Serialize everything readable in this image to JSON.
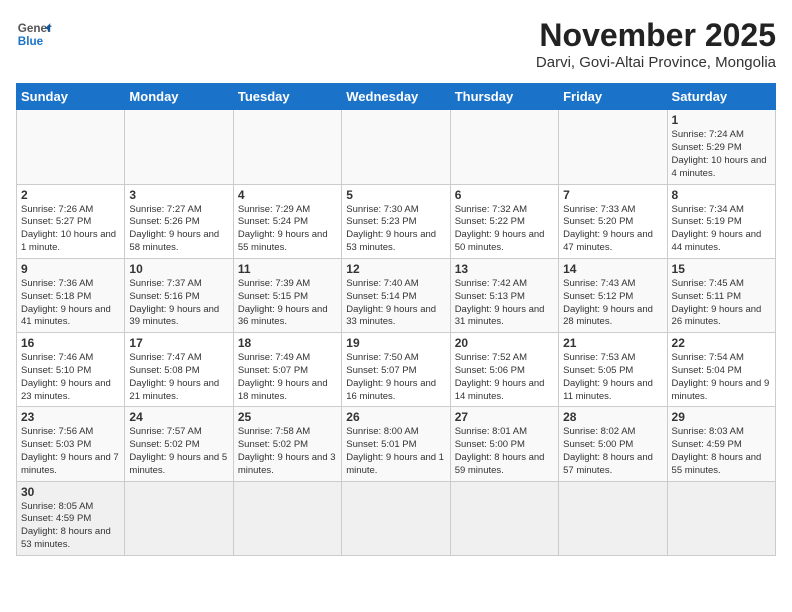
{
  "header": {
    "logo_line1": "General",
    "logo_line2": "Blue",
    "month": "November 2025",
    "location": "Darvi, Govi-Altai Province, Mongolia"
  },
  "days_of_week": [
    "Sunday",
    "Monday",
    "Tuesday",
    "Wednesday",
    "Thursday",
    "Friday",
    "Saturday"
  ],
  "weeks": [
    {
      "cells": [
        {
          "day": "",
          "info": ""
        },
        {
          "day": "",
          "info": ""
        },
        {
          "day": "",
          "info": ""
        },
        {
          "day": "",
          "info": ""
        },
        {
          "day": "",
          "info": ""
        },
        {
          "day": "",
          "info": ""
        },
        {
          "day": "1",
          "info": "Sunrise: 7:24 AM\nSunset: 5:29 PM\nDaylight: 10 hours\nand 4 minutes."
        }
      ]
    },
    {
      "cells": [
        {
          "day": "2",
          "info": "Sunrise: 7:26 AM\nSunset: 5:27 PM\nDaylight: 10 hours\nand 1 minute."
        },
        {
          "day": "3",
          "info": "Sunrise: 7:27 AM\nSunset: 5:26 PM\nDaylight: 9 hours\nand 58 minutes."
        },
        {
          "day": "4",
          "info": "Sunrise: 7:29 AM\nSunset: 5:24 PM\nDaylight: 9 hours\nand 55 minutes."
        },
        {
          "day": "5",
          "info": "Sunrise: 7:30 AM\nSunset: 5:23 PM\nDaylight: 9 hours\nand 53 minutes."
        },
        {
          "day": "6",
          "info": "Sunrise: 7:32 AM\nSunset: 5:22 PM\nDaylight: 9 hours\nand 50 minutes."
        },
        {
          "day": "7",
          "info": "Sunrise: 7:33 AM\nSunset: 5:20 PM\nDaylight: 9 hours\nand 47 minutes."
        },
        {
          "day": "8",
          "info": "Sunrise: 7:34 AM\nSunset: 5:19 PM\nDaylight: 9 hours\nand 44 minutes."
        }
      ]
    },
    {
      "cells": [
        {
          "day": "9",
          "info": "Sunrise: 7:36 AM\nSunset: 5:18 PM\nDaylight: 9 hours\nand 41 minutes."
        },
        {
          "day": "10",
          "info": "Sunrise: 7:37 AM\nSunset: 5:16 PM\nDaylight: 9 hours\nand 39 minutes."
        },
        {
          "day": "11",
          "info": "Sunrise: 7:39 AM\nSunset: 5:15 PM\nDaylight: 9 hours\nand 36 minutes."
        },
        {
          "day": "12",
          "info": "Sunrise: 7:40 AM\nSunset: 5:14 PM\nDaylight: 9 hours\nand 33 minutes."
        },
        {
          "day": "13",
          "info": "Sunrise: 7:42 AM\nSunset: 5:13 PM\nDaylight: 9 hours\nand 31 minutes."
        },
        {
          "day": "14",
          "info": "Sunrise: 7:43 AM\nSunset: 5:12 PM\nDaylight: 9 hours\nand 28 minutes."
        },
        {
          "day": "15",
          "info": "Sunrise: 7:45 AM\nSunset: 5:11 PM\nDaylight: 9 hours\nand 26 minutes."
        }
      ]
    },
    {
      "cells": [
        {
          "day": "16",
          "info": "Sunrise: 7:46 AM\nSunset: 5:10 PM\nDaylight: 9 hours\nand 23 minutes."
        },
        {
          "day": "17",
          "info": "Sunrise: 7:47 AM\nSunset: 5:08 PM\nDaylight: 9 hours\nand 21 minutes."
        },
        {
          "day": "18",
          "info": "Sunrise: 7:49 AM\nSunset: 5:07 PM\nDaylight: 9 hours\nand 18 minutes."
        },
        {
          "day": "19",
          "info": "Sunrise: 7:50 AM\nSunset: 5:07 PM\nDaylight: 9 hours\nand 16 minutes."
        },
        {
          "day": "20",
          "info": "Sunrise: 7:52 AM\nSunset: 5:06 PM\nDaylight: 9 hours\nand 14 minutes."
        },
        {
          "day": "21",
          "info": "Sunrise: 7:53 AM\nSunset: 5:05 PM\nDaylight: 9 hours\nand 11 minutes."
        },
        {
          "day": "22",
          "info": "Sunrise: 7:54 AM\nSunset: 5:04 PM\nDaylight: 9 hours\nand 9 minutes."
        }
      ]
    },
    {
      "cells": [
        {
          "day": "23",
          "info": "Sunrise: 7:56 AM\nSunset: 5:03 PM\nDaylight: 9 hours\nand 7 minutes."
        },
        {
          "day": "24",
          "info": "Sunrise: 7:57 AM\nSunset: 5:02 PM\nDaylight: 9 hours\nand 5 minutes."
        },
        {
          "day": "25",
          "info": "Sunrise: 7:58 AM\nSunset: 5:02 PM\nDaylight: 9 hours\nand 3 minutes."
        },
        {
          "day": "26",
          "info": "Sunrise: 8:00 AM\nSunset: 5:01 PM\nDaylight: 9 hours\nand 1 minute."
        },
        {
          "day": "27",
          "info": "Sunrise: 8:01 AM\nSunset: 5:00 PM\nDaylight: 8 hours\nand 59 minutes."
        },
        {
          "day": "28",
          "info": "Sunrise: 8:02 AM\nSunset: 5:00 PM\nDaylight: 8 hours\nand 57 minutes."
        },
        {
          "day": "29",
          "info": "Sunrise: 8:03 AM\nSunset: 4:59 PM\nDaylight: 8 hours\nand 55 minutes."
        }
      ]
    },
    {
      "cells": [
        {
          "day": "30",
          "info": "Sunrise: 8:05 AM\nSunset: 4:59 PM\nDaylight: 8 hours\nand 53 minutes."
        },
        {
          "day": "",
          "info": ""
        },
        {
          "day": "",
          "info": ""
        },
        {
          "day": "",
          "info": ""
        },
        {
          "day": "",
          "info": ""
        },
        {
          "day": "",
          "info": ""
        },
        {
          "day": "",
          "info": ""
        }
      ]
    }
  ]
}
